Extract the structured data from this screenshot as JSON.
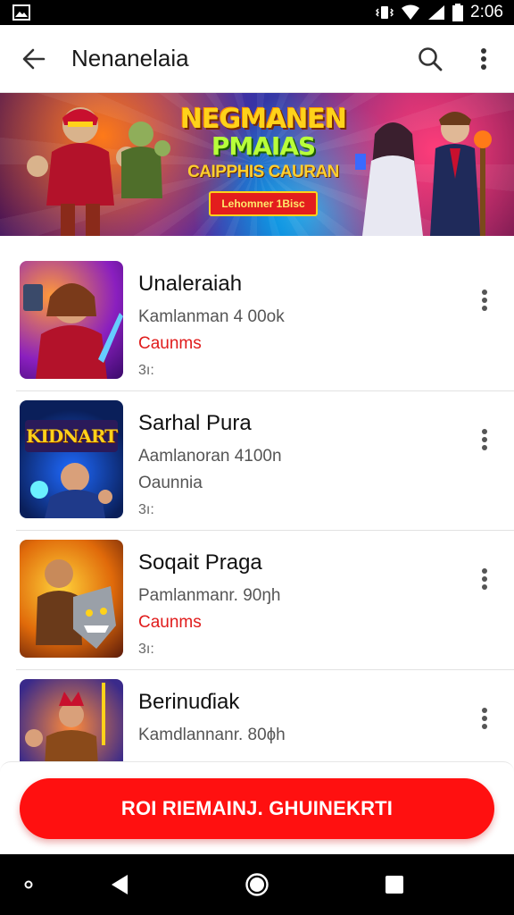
{
  "status_bar": {
    "time": "2:06"
  },
  "app_bar": {
    "title": "Nenanelaia"
  },
  "banner": {
    "line1": "NEGMANEN",
    "line2": "PMAIAS",
    "line3": "CAIPPHIS CAURAN",
    "button": "Lehomner 1Bisc"
  },
  "list": {
    "items": [
      {
        "name": "Unaleraiah",
        "meta": "Kamlanman 4 00ok",
        "tag": "Caunms",
        "tag_color": "#e01b1b",
        "small": "3ı:"
      },
      {
        "name": "Sarhal Pura",
        "meta": "Aamlanoran 4100n",
        "tag": "Oaunnia",
        "tag_color": "#555555",
        "small": "3ı:"
      },
      {
        "name": "Soqait Praga",
        "meta": "Pamlanmanr. 90ŋh",
        "tag": "Caunms",
        "tag_color": "#e01b1b",
        "small": "3ı:"
      },
      {
        "name": "Berinuɗiak",
        "meta": "Kamdlannanr. 80ɸh",
        "tag": "",
        "tag_color": "#555555",
        "small": ""
      }
    ]
  },
  "thumb_2_text": "KIDNART",
  "cta": {
    "label": "ROI RIEMAINJ. GHUINEKRTI"
  },
  "colors": {
    "accent": "#ff1010",
    "status_bar": "#000000",
    "nav_bar": "#000000"
  },
  "icons": [
    "back-arrow-icon",
    "search-icon",
    "more-vert-icon",
    "nav-back-icon",
    "nav-home-icon",
    "nav-recents-icon"
  ]
}
